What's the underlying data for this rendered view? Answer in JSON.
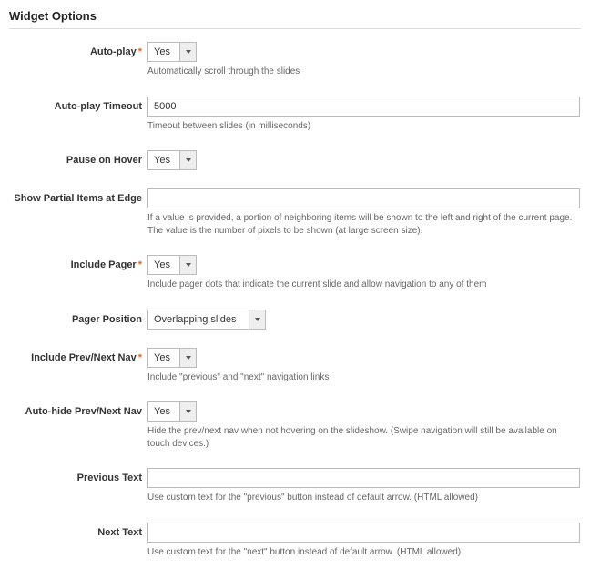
{
  "section_title": "Widget Options",
  "yes_label": "Yes",
  "fields": {
    "autoplay": {
      "label": "Auto-play",
      "required_mark": "*",
      "value": "Yes",
      "hint": "Automatically scroll through the slides"
    },
    "autoplay_timeout": {
      "label": "Auto-play Timeout",
      "value": "5000",
      "hint": "Timeout between slides (in milliseconds)"
    },
    "pause_on_hover": {
      "label": "Pause on Hover",
      "value": "Yes"
    },
    "show_partial": {
      "label": "Show Partial Items at Edge",
      "value": "",
      "hint": "If a value is provided, a portion of neighboring items will be shown to the left and right of the current page. The value is the number of pixels to be shown (at large screen size)."
    },
    "include_pager": {
      "label": "Include Pager",
      "required_mark": "*",
      "value": "Yes",
      "hint": "Include pager dots that indicate the current slide and allow navigation to any of them"
    },
    "pager_position": {
      "label": "Pager Position",
      "value": "Overlapping slides"
    },
    "include_nav": {
      "label": "Include Prev/Next Nav",
      "required_mark": "*",
      "value": "Yes",
      "hint": "Include \"previous\" and \"next\" navigation links"
    },
    "autohide_nav": {
      "label": "Auto-hide Prev/Next Nav",
      "value": "Yes",
      "hint": "Hide the prev/next nav when not hovering on the slideshow. (Swipe navigation will still be available on touch devices.)"
    },
    "prev_text": {
      "label": "Previous Text",
      "value": "",
      "hint": "Use custom text for the \"previous\" button instead of default arrow. (HTML allowed)"
    },
    "next_text": {
      "label": "Next Text",
      "value": "",
      "hint": "Use custom text for the \"next\" button instead of default arrow. (HTML allowed)"
    }
  }
}
